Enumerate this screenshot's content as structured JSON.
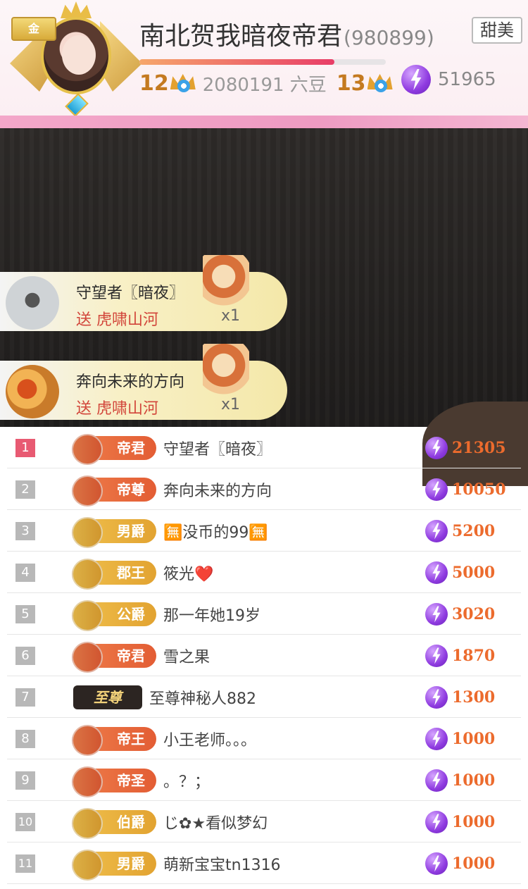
{
  "header": {
    "avatar_badge": "金",
    "host_name": "南北贺我暗夜帝君",
    "host_id": "(980899)",
    "tag": "甜美",
    "level_current": "12",
    "beans": "2080191 六豆",
    "level_next": "13",
    "progress_fraction": 0.79,
    "coin_total": "51965"
  },
  "gifts": [
    {
      "user": "守望者〖暗夜〗",
      "action": "送 虎啸山河",
      "count": "x1"
    },
    {
      "user": "奔向未来的方向",
      "action": "送 虎啸山河",
      "count": "x1"
    }
  ],
  "ranking": [
    {
      "rank": "1",
      "badge": "帝君",
      "badge_style": "red",
      "name": "守望者〖暗夜〗",
      "coins": "21305"
    },
    {
      "rank": "2",
      "badge": "帝尊",
      "badge_style": "red",
      "name": "奔向未来的方向",
      "coins": "10050"
    },
    {
      "rank": "3",
      "badge": "男爵",
      "badge_style": "gold",
      "name": "🈚没币的99🈚",
      "coins": "5200"
    },
    {
      "rank": "4",
      "badge": "郡王",
      "badge_style": "gold",
      "name": "筱光❤️",
      "coins": "5000"
    },
    {
      "rank": "5",
      "badge": "公爵",
      "badge_style": "gold",
      "name": "那一年她19岁",
      "coins": "3020"
    },
    {
      "rank": "6",
      "badge": "帝君",
      "badge_style": "red",
      "name": "雪之果",
      "coins": "1870"
    },
    {
      "rank": "7",
      "badge": "至尊",
      "badge_style": "black",
      "name": "至尊神秘人882",
      "coins": "1300"
    },
    {
      "rank": "8",
      "badge": "帝王",
      "badge_style": "red",
      "name": "小王老师。。。",
      "coins": "1000"
    },
    {
      "rank": "9",
      "badge": "帝圣",
      "badge_style": "red",
      "name": "。？；",
      "coins": "1000"
    },
    {
      "rank": "10",
      "badge": "伯爵",
      "badge_style": "gold",
      "name": "じ✿★看似梦幻",
      "coins": "1000"
    },
    {
      "rank": "11",
      "badge": "男爵",
      "badge_style": "gold",
      "name": "萌新宝宝tn1316",
      "coins": "1000"
    }
  ],
  "icons": {
    "coin": "lightning-coin-icon",
    "level": "crown-icon"
  },
  "colors": {
    "accent_pink": "#ee9bc2",
    "coin_value": "#ec6b2d",
    "rank_top": "#e85a72"
  }
}
